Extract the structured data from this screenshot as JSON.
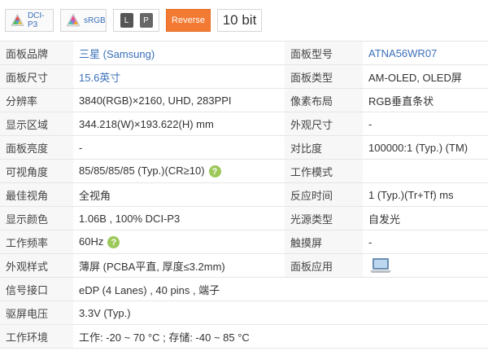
{
  "badges": {
    "dci_p3": {
      "label": "DCI-P3",
      "icon": "color-gamut-triangle-icon"
    },
    "srgb": {
      "label": "sRGB",
      "icon": "color-gamut-triangle-icon"
    },
    "lp": {
      "l": "L",
      "p": "P"
    },
    "reverse": {
      "label": "Reverse",
      "color": "#f37a33"
    },
    "bit": {
      "label": "10 bit"
    }
  },
  "colors": {
    "link": "#3a6fb8",
    "help_icon": "#9dc85a",
    "label_bg": "#f7f7f7"
  },
  "rows": [
    {
      "l1": "面板品牌",
      "v1": "三星 (Samsung)",
      "l2": "面板型号",
      "v2": "ATNA56WR07"
    },
    {
      "l1": "面板尺寸",
      "v1": "15.6英寸",
      "l2": "面板类型",
      "v2": "AM-OLED, OLED屏"
    },
    {
      "l1": "分辨率",
      "v1": "3840(RGB)×2160, UHD, 283PPI",
      "l2": "像素布局",
      "v2": "RGB垂直条状"
    },
    {
      "l1": "显示区域",
      "v1": "344.218(W)×193.622(H) mm",
      "l2": "外观尺寸",
      "v2": "-"
    },
    {
      "l1": "面板亮度",
      "v1": "-",
      "l2": "对比度",
      "v2": "100000:1 (Typ.) (TM)"
    },
    {
      "l1": "可视角度",
      "v1": "85/85/85/85 (Typ.)(CR≥10)",
      "l2": "工作模式",
      "v2": ""
    },
    {
      "l1": "最佳视角",
      "v1": "全视角",
      "l2": "反应时间",
      "v2": "1 (Typ.)(Tr+Tf) ms"
    },
    {
      "l1": "显示颜色",
      "v1": "1.06B , 100% DCI-P3",
      "l2": "光源类型",
      "v2": "自发光"
    },
    {
      "l1": "工作频率",
      "v1": "60Hz",
      "l2": "触摸屏",
      "v2": "-"
    },
    {
      "l1": "外观样式",
      "v1": "薄屏 (PCBA平直, 厚度≤3.2mm)",
      "l2": "面板应用",
      "v2_icon": "laptop-icon"
    },
    {
      "l1": "信号接口",
      "v1": "eDP (4 Lanes) , 40 pins , 端子"
    },
    {
      "l1": "驱屏电压",
      "v1": "3.3V (Typ.)"
    },
    {
      "l1": "工作环境",
      "v1": "工作: -20 ~ 70 °C ; 存储: -40 ~ 85 °C"
    }
  ],
  "help_glyph": "?"
}
